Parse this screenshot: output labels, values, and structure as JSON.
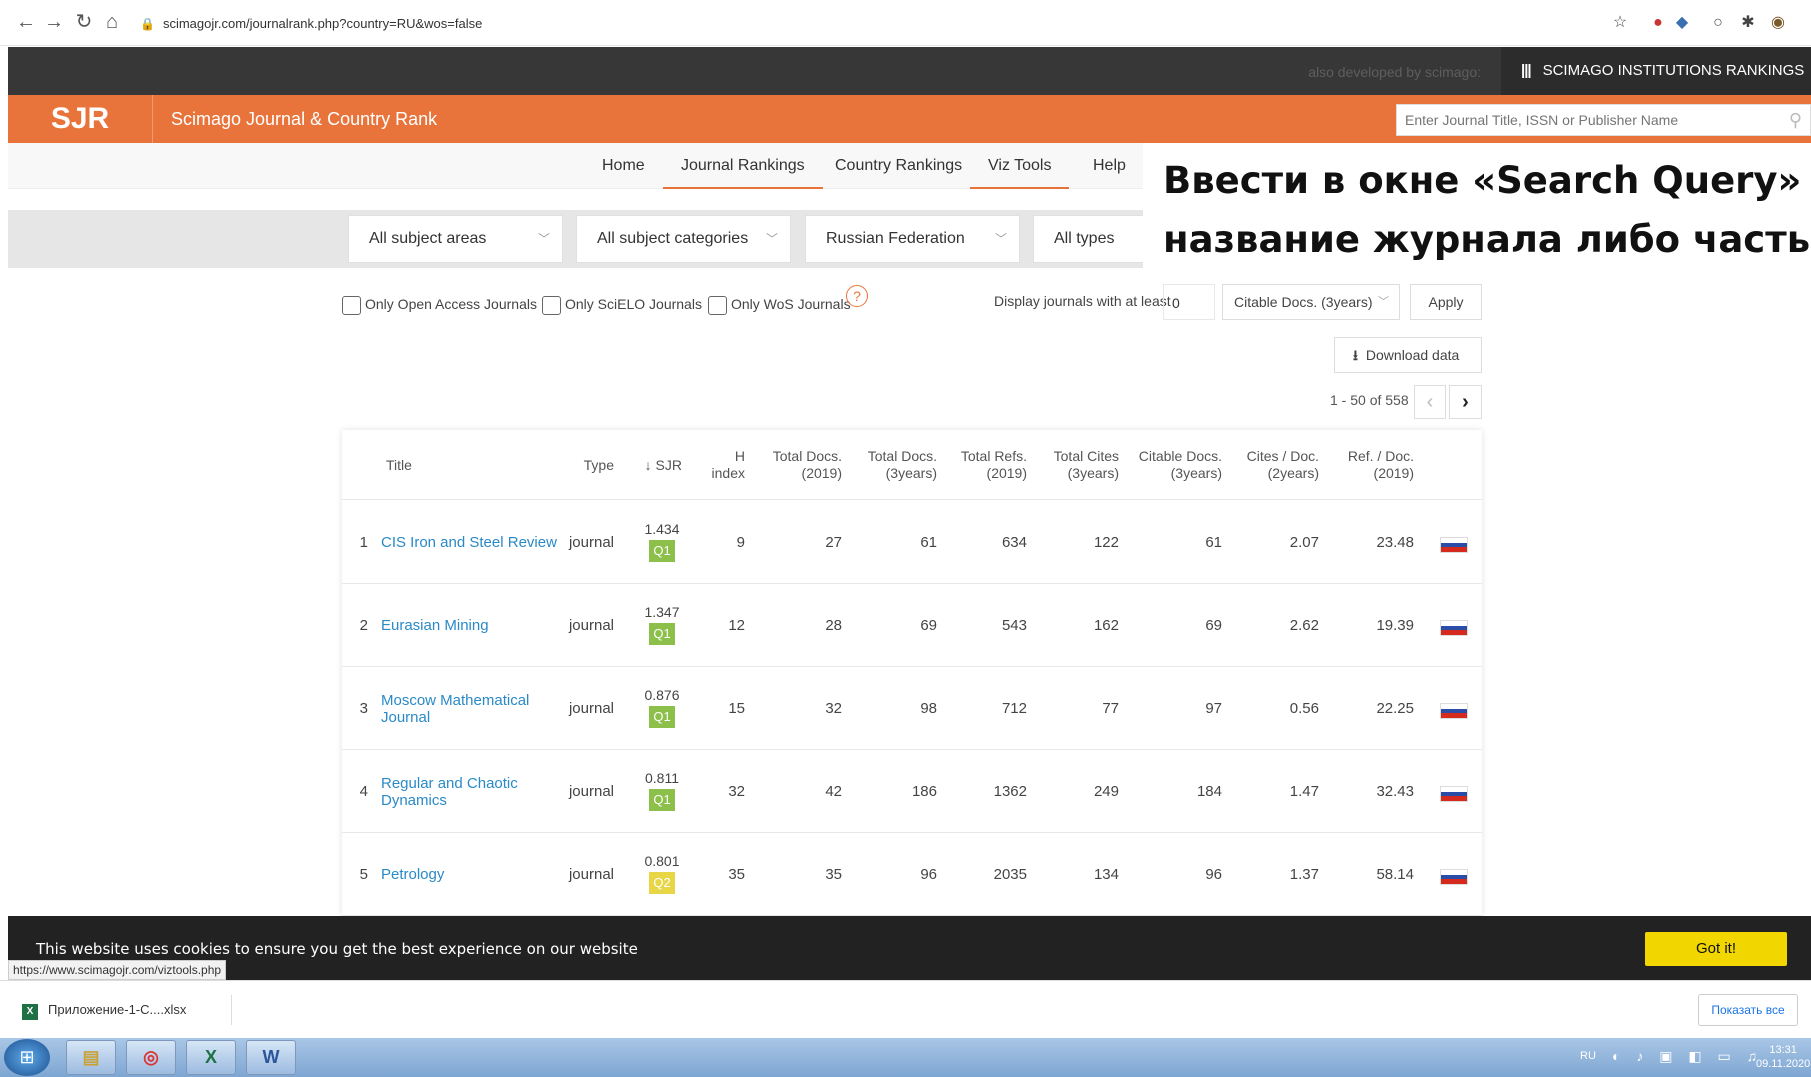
{
  "browser": {
    "url": "scimagojr.com/journalrank.php?country=RU&wos=false",
    "status_url": "https://www.scimagojr.com/viztools.php"
  },
  "top_strip": {
    "also_developed": "also developed by scimago:",
    "sir_label": "SCIMAGO INSTITUTIONS RANKINGS"
  },
  "header": {
    "logo": "SJR",
    "site_name": "Scimago Journal & Country Rank",
    "search_placeholder": "Enter Journal Title, ISSN or Publisher Name"
  },
  "nav": {
    "items": [
      "Home",
      "Journal Rankings",
      "Country Rankings",
      "Viz Tools",
      "Help"
    ]
  },
  "annotation": {
    "line1": "Ввести в окне «Search Query» –",
    "line2": "название журнала либо часть н"
  },
  "filters": {
    "subject_area": "All subject areas",
    "subject_category": "All subject categories",
    "country": "Russian Federation",
    "type": "All types"
  },
  "options": {
    "open_access": "Only Open Access Journals",
    "scielo": "Only SciELO Journals",
    "wos": "Only WoS Journals",
    "help_icon": "?",
    "min_label": "Display journals with at least",
    "min_value": "0",
    "metric": "Citable Docs. (3years)",
    "apply": "Apply",
    "download": "Download data",
    "range": "1 - 50 of 558"
  },
  "table": {
    "headers": {
      "title": "Title",
      "type": "Type",
      "sjr": "↓ SJR",
      "h_index_1": "H",
      "h_index_2": "index",
      "total_docs_1": "Total Docs.",
      "total_docs_2": "(2019)",
      "total_docs3_1": "Total Docs.",
      "total_docs3_2": "(3years)",
      "total_refs_1": "Total Refs.",
      "total_refs_2": "(2019)",
      "total_cites_1": "Total Cites",
      "total_cites_2": "(3years)",
      "citable_1": "Citable Docs.",
      "citable_2": "(3years)",
      "cites_doc_1": "Cites / Doc.",
      "cites_doc_2": "(2years)",
      "ref_doc_1": "Ref. / Doc.",
      "ref_doc_2": "(2019)"
    },
    "rows": [
      {
        "rank": "1",
        "title": "CIS Iron and Steel Review",
        "type": "journal",
        "sjr": "1.434",
        "quartile": "Q1",
        "h": "9",
        "docs2019": "27",
        "docs3y": "61",
        "refs": "634",
        "cites3y": "122",
        "citable": "61",
        "cites_doc": "2.07",
        "ref_doc": "23.48"
      },
      {
        "rank": "2",
        "title": "Eurasian Mining",
        "type": "journal",
        "sjr": "1.347",
        "quartile": "Q1",
        "h": "12",
        "docs2019": "28",
        "docs3y": "69",
        "refs": "543",
        "cites3y": "162",
        "citable": "69",
        "cites_doc": "2.62",
        "ref_doc": "19.39"
      },
      {
        "rank": "3",
        "title": "Moscow Mathematical Journal",
        "type": "journal",
        "sjr": "0.876",
        "quartile": "Q1",
        "h": "15",
        "docs2019": "32",
        "docs3y": "98",
        "refs": "712",
        "cites3y": "77",
        "citable": "97",
        "cites_doc": "0.56",
        "ref_doc": "22.25"
      },
      {
        "rank": "4",
        "title": "Regular and Chaotic Dynamics",
        "type": "journal",
        "sjr": "0.811",
        "quartile": "Q1",
        "h": "32",
        "docs2019": "42",
        "docs3y": "186",
        "refs": "1362",
        "cites3y": "249",
        "citable": "184",
        "cites_doc": "1.47",
        "ref_doc": "32.43"
      },
      {
        "rank": "5",
        "title": "Petrology",
        "type": "journal",
        "sjr": "0.801",
        "quartile": "Q2",
        "h": "35",
        "docs2019": "35",
        "docs3y": "96",
        "refs": "2035",
        "cites3y": "134",
        "citable": "96",
        "cites_doc": "1.37",
        "ref_doc": "58.14"
      }
    ]
  },
  "colors": {
    "orange": "#e8743b",
    "q1": "#8cc04a",
    "q2": "#e8d647",
    "link": "#2a8ac7"
  },
  "cookie": {
    "text": "This website uses cookies to ensure you get the best experience on our website",
    "button": "Got it!"
  },
  "downloads": {
    "file": "Приложение-1-С....xlsx",
    "show_all": "Показать все"
  },
  "taskbar": {
    "lang": "RU",
    "time": "13:31",
    "date": "09.11.2020"
  }
}
